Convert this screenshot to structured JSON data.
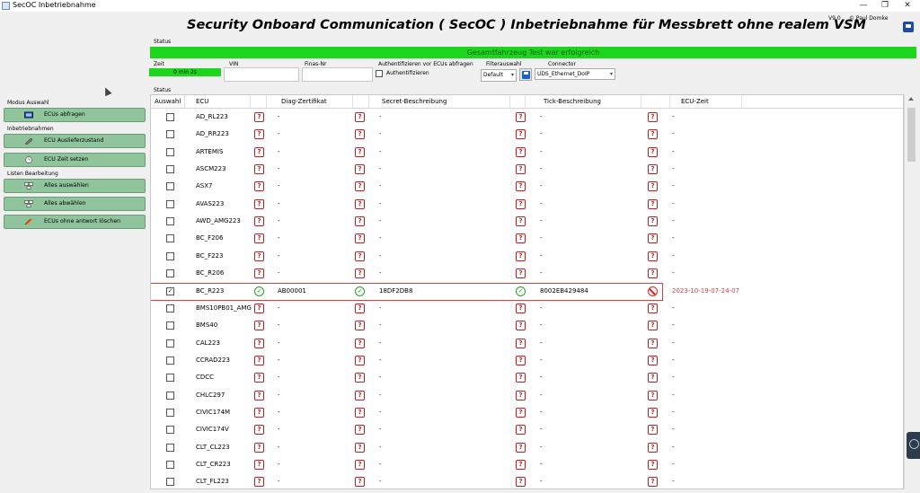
{
  "window": {
    "title": "SecOC Inbetriebnahme",
    "controls": {
      "minimize": "—",
      "maximize": "❐",
      "close": "✕"
    }
  },
  "header": {
    "title": "Security Onboard Communication ( SecOC ) Inbetriebnahme für Messbrett ohne realem VSM",
    "version": "V9.0",
    "copyright": "© Paul Domke"
  },
  "status_section": {
    "label": "Status",
    "message": "Gesamtfahrzeug Test war erfolgreich",
    "status_color": "#1ed51e"
  },
  "info_row": {
    "zeit_label": "Zeit",
    "zeit_value": "0 min 2s",
    "vin_label": "VIN",
    "vin_value": "",
    "finas_label": "Finas-Nr",
    "finas_value": "",
    "auth_label": "Authentifizieren vor ECUs abfragen",
    "auth_checkbox_label": "Authentifizieren",
    "auth_checked": false,
    "filter_label": "Filterauswahl",
    "filter_value": "Default",
    "connector_label": "Connector",
    "connector_value": "UDS_Ethernet_DoIP"
  },
  "sidebar": {
    "groups": [
      {
        "label": "Modus Auswahl",
        "buttons": [
          {
            "label": "ECUs abfragen",
            "icon": "ecu-query-icon"
          }
        ]
      },
      {
        "label": "Inbetriebnahmen",
        "buttons": [
          {
            "label": "ECU Auslieferzustand",
            "icon": "wrench-icon"
          },
          {
            "label": "ECU Zeit setzen",
            "icon": "clock-icon"
          }
        ]
      },
      {
        "label": "Listen Bearbeitung",
        "buttons": [
          {
            "label": "Alles auswählen",
            "icon": "select-all-icon"
          },
          {
            "label": "Alles abwählen",
            "icon": "deselect-all-icon"
          },
          {
            "label": "ECUs ohne antwort löschen",
            "icon": "delete-icon"
          }
        ]
      }
    ],
    "button_color": "#8fc49c"
  },
  "grid": {
    "section_label": "Status",
    "columns": [
      "Auswahl",
      "ECU",
      "Diag-Zertifikat",
      "Secret-Beschreibung",
      "Tick-Beschreibung",
      "ECU-Zeit"
    ],
    "rows": [
      {
        "ecu": "AD_RL223",
        "selected": false,
        "s1": "unknown",
        "diag": "-",
        "s2": "unknown",
        "secret": "-",
        "s3": "unknown",
        "tick": "-",
        "s4": "unknown",
        "time": "-"
      },
      {
        "ecu": "AD_RR223",
        "selected": false,
        "s1": "unknown",
        "diag": "-",
        "s2": "unknown",
        "secret": "-",
        "s3": "unknown",
        "tick": "-",
        "s4": "unknown",
        "time": "-"
      },
      {
        "ecu": "ARTEMIS",
        "selected": false,
        "s1": "unknown",
        "diag": "-",
        "s2": "unknown",
        "secret": "-",
        "s3": "unknown",
        "tick": "-",
        "s4": "unknown",
        "time": "-"
      },
      {
        "ecu": "ASCM223",
        "selected": false,
        "s1": "unknown",
        "diag": "-",
        "s2": "unknown",
        "secret": "-",
        "s3": "unknown",
        "tick": "-",
        "s4": "unknown",
        "time": "-"
      },
      {
        "ecu": "ASX7",
        "selected": false,
        "s1": "unknown",
        "diag": "-",
        "s2": "unknown",
        "secret": "-",
        "s3": "unknown",
        "tick": "-",
        "s4": "unknown",
        "time": "-"
      },
      {
        "ecu": "AVAS223",
        "selected": false,
        "s1": "unknown",
        "diag": "-",
        "s2": "unknown",
        "secret": "-",
        "s3": "unknown",
        "tick": "-",
        "s4": "unknown",
        "time": "-"
      },
      {
        "ecu": "AWD_AMG223",
        "selected": false,
        "s1": "unknown",
        "diag": "-",
        "s2": "unknown",
        "secret": "-",
        "s3": "unknown",
        "tick": "-",
        "s4": "unknown",
        "time": "-"
      },
      {
        "ecu": "BC_F206",
        "selected": false,
        "s1": "unknown",
        "diag": "-",
        "s2": "unknown",
        "secret": "-",
        "s3": "unknown",
        "tick": "-",
        "s4": "unknown",
        "time": "-"
      },
      {
        "ecu": "BC_F223",
        "selected": false,
        "s1": "unknown",
        "diag": "-",
        "s2": "unknown",
        "secret": "-",
        "s3": "unknown",
        "tick": "-",
        "s4": "unknown",
        "time": "-"
      },
      {
        "ecu": "BC_R206",
        "selected": false,
        "s1": "unknown",
        "diag": "-",
        "s2": "unknown",
        "secret": "-",
        "s3": "unknown",
        "tick": "-",
        "s4": "unknown",
        "time": "-"
      },
      {
        "ecu": "BC_R223",
        "selected": true,
        "highlight": true,
        "s1": "ok",
        "diag": "AB00001",
        "s2": "ok",
        "secret": "18DF2DB8",
        "s3": "ok",
        "tick": "8002EB429484",
        "s4": "error",
        "time": "2023-10-19-07-24-07"
      },
      {
        "ecu": "BMS10PB01_AMG",
        "selected": false,
        "s1": "unknown",
        "diag": "-",
        "s2": "unknown",
        "secret": "-",
        "s3": "unknown",
        "tick": "-",
        "s4": "unknown",
        "time": "-"
      },
      {
        "ecu": "BMS40",
        "selected": false,
        "s1": "unknown",
        "diag": "-",
        "s2": "unknown",
        "secret": "-",
        "s3": "unknown",
        "tick": "-",
        "s4": "unknown",
        "time": "-"
      },
      {
        "ecu": "CAL223",
        "selected": false,
        "s1": "unknown",
        "diag": "-",
        "s2": "unknown",
        "secret": "-",
        "s3": "unknown",
        "tick": "-",
        "s4": "unknown",
        "time": "-"
      },
      {
        "ecu": "CCRAD223",
        "selected": false,
        "s1": "unknown",
        "diag": "-",
        "s2": "unknown",
        "secret": "-",
        "s3": "unknown",
        "tick": "-",
        "s4": "unknown",
        "time": "-"
      },
      {
        "ecu": "CDCC",
        "selected": false,
        "s1": "unknown",
        "diag": "-",
        "s2": "unknown",
        "secret": "-",
        "s3": "unknown",
        "tick": "-",
        "s4": "unknown",
        "time": "-"
      },
      {
        "ecu": "CHLC297",
        "selected": false,
        "s1": "unknown",
        "diag": "-",
        "s2": "unknown",
        "secret": "-",
        "s3": "unknown",
        "tick": "-",
        "s4": "unknown",
        "time": "-"
      },
      {
        "ecu": "CIVIC174M",
        "selected": false,
        "s1": "unknown",
        "diag": "-",
        "s2": "unknown",
        "secret": "-",
        "s3": "unknown",
        "tick": "-",
        "s4": "unknown",
        "time": "-"
      },
      {
        "ecu": "CIVIC174V",
        "selected": false,
        "s1": "unknown",
        "diag": "-",
        "s2": "unknown",
        "secret": "-",
        "s3": "unknown",
        "tick": "-",
        "s4": "unknown",
        "time": "-"
      },
      {
        "ecu": "CLT_CL223",
        "selected": false,
        "s1": "unknown",
        "diag": "-",
        "s2": "unknown",
        "secret": "-",
        "s3": "unknown",
        "tick": "-",
        "s4": "unknown",
        "time": "-"
      },
      {
        "ecu": "CLT_CR223",
        "selected": false,
        "s1": "unknown",
        "diag": "-",
        "s2": "unknown",
        "secret": "-",
        "s3": "unknown",
        "tick": "-",
        "s4": "unknown",
        "time": "-"
      },
      {
        "ecu": "CLT_FL223",
        "selected": false,
        "s1": "unknown",
        "diag": "-",
        "s2": "unknown",
        "secret": "-",
        "s3": "unknown",
        "tick": "-",
        "s4": "unknown",
        "time": "-"
      }
    ],
    "error_text_color": "#e03a3a"
  }
}
